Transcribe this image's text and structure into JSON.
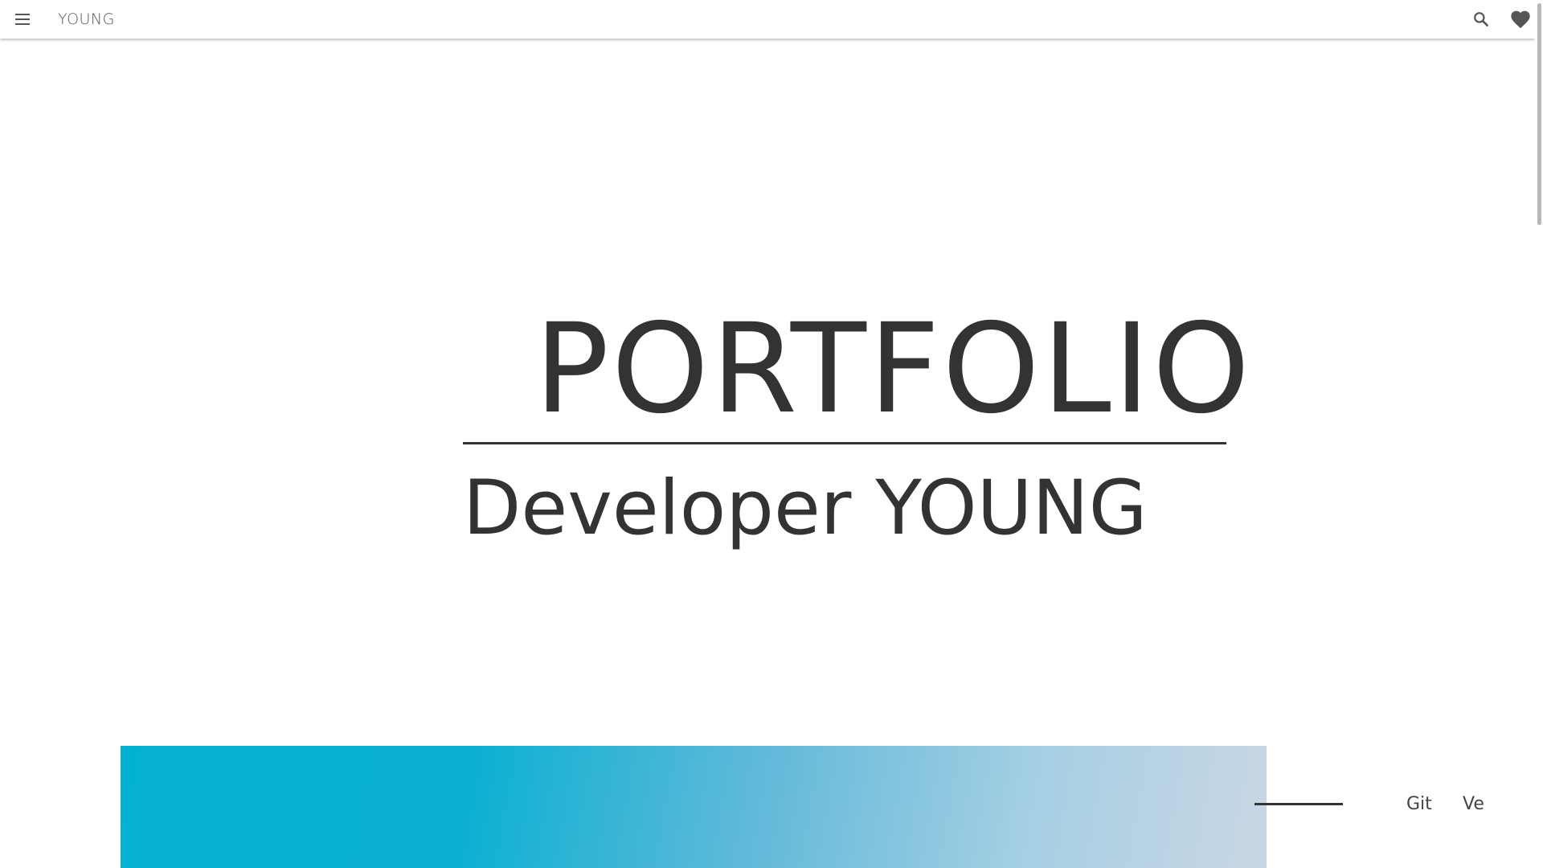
{
  "header": {
    "brand": "YOUNG",
    "menu_icon": "menu-icon",
    "search_icon": "search-icon",
    "heart_icon": "heart-icon"
  },
  "hero": {
    "title": "PORTFOLIO",
    "subtitle": "Developer YOUNG"
  },
  "side_links": [
    {
      "label": "Git"
    },
    {
      "label": "Ve"
    }
  ],
  "colors": {
    "text": "#333333",
    "banner_start": "#05b1d3",
    "banner_end": "#c9d6e4"
  }
}
